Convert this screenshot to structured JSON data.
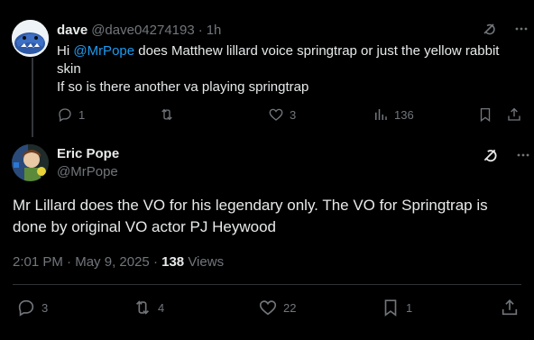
{
  "reply": {
    "name": "dave",
    "handle": "@dave04274193",
    "separator": "·",
    "time": "1h",
    "text_mention": "@MrPope",
    "text_prefix": "Hi ",
    "text_rest": " does Matthew lillard voice springtrap or just the yellow rabbit skin",
    "text_line2": "If so is there another va playing springtrap",
    "replies": "1",
    "likes": "3",
    "views": "136"
  },
  "tweet": {
    "name": "Eric Pope",
    "handle": "@MrPope",
    "text": "Mr Lillard does the VO for his legendary only. The VO for Springtrap is done by original VO actor PJ Heywood",
    "time": "2:01 PM",
    "date_sep": "·",
    "date": "May 9, 2025",
    "dot": "·",
    "views_count": "138",
    "views_label": "Views",
    "replies": "3",
    "reposts": "4",
    "likes": "22",
    "bookmarks": "1"
  },
  "colors": {
    "background": "#000000",
    "text": "#e7e9ea",
    "muted": "#71767b",
    "link": "#1d9bf0",
    "divider": "#2f3336"
  },
  "icons": [
    "grok-icon",
    "more-icon",
    "reply-icon",
    "repost-icon",
    "like-icon",
    "views-icon",
    "bookmark-icon",
    "share-icon"
  ]
}
